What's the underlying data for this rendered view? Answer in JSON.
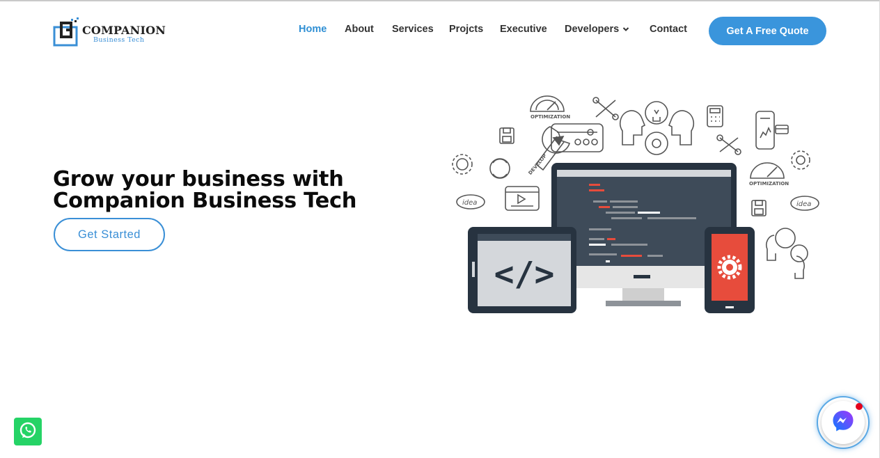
{
  "brand": {
    "name": "COMPANION",
    "tagline": "Business Tech"
  },
  "nav": {
    "items": [
      {
        "label": "Home",
        "active": true
      },
      {
        "label": "About",
        "active": false
      },
      {
        "label": "Services",
        "active": false
      },
      {
        "label": "Projcts",
        "active": false
      },
      {
        "label": "Executive",
        "active": false
      },
      {
        "label": "Developers",
        "active": false,
        "has_dropdown": true
      },
      {
        "label": "Contact",
        "active": false
      }
    ],
    "cta_label": "Get A Free Quote"
  },
  "hero": {
    "title_line1": "Grow your business with",
    "title_line2": "Companion Business Tech",
    "button_label": "Get Started"
  },
  "illustration": {
    "labels": {
      "optimization": "OPTIMIZATION",
      "develop": "DEVELOP",
      "idea": "idea"
    },
    "code_glyph": "</>"
  },
  "floating": {
    "whatsapp_icon": "whatsapp-icon",
    "messenger_icon": "messenger-icon",
    "notification": true
  },
  "colors": {
    "accent": "#3a95dc",
    "active_nav": "#2f8fd4",
    "nav_text": "#333333",
    "monitor_screen": "#3e4b59",
    "phone_screen": "#e74c3c",
    "whatsapp": "#25d366",
    "notification_dot": "#e4001b"
  }
}
